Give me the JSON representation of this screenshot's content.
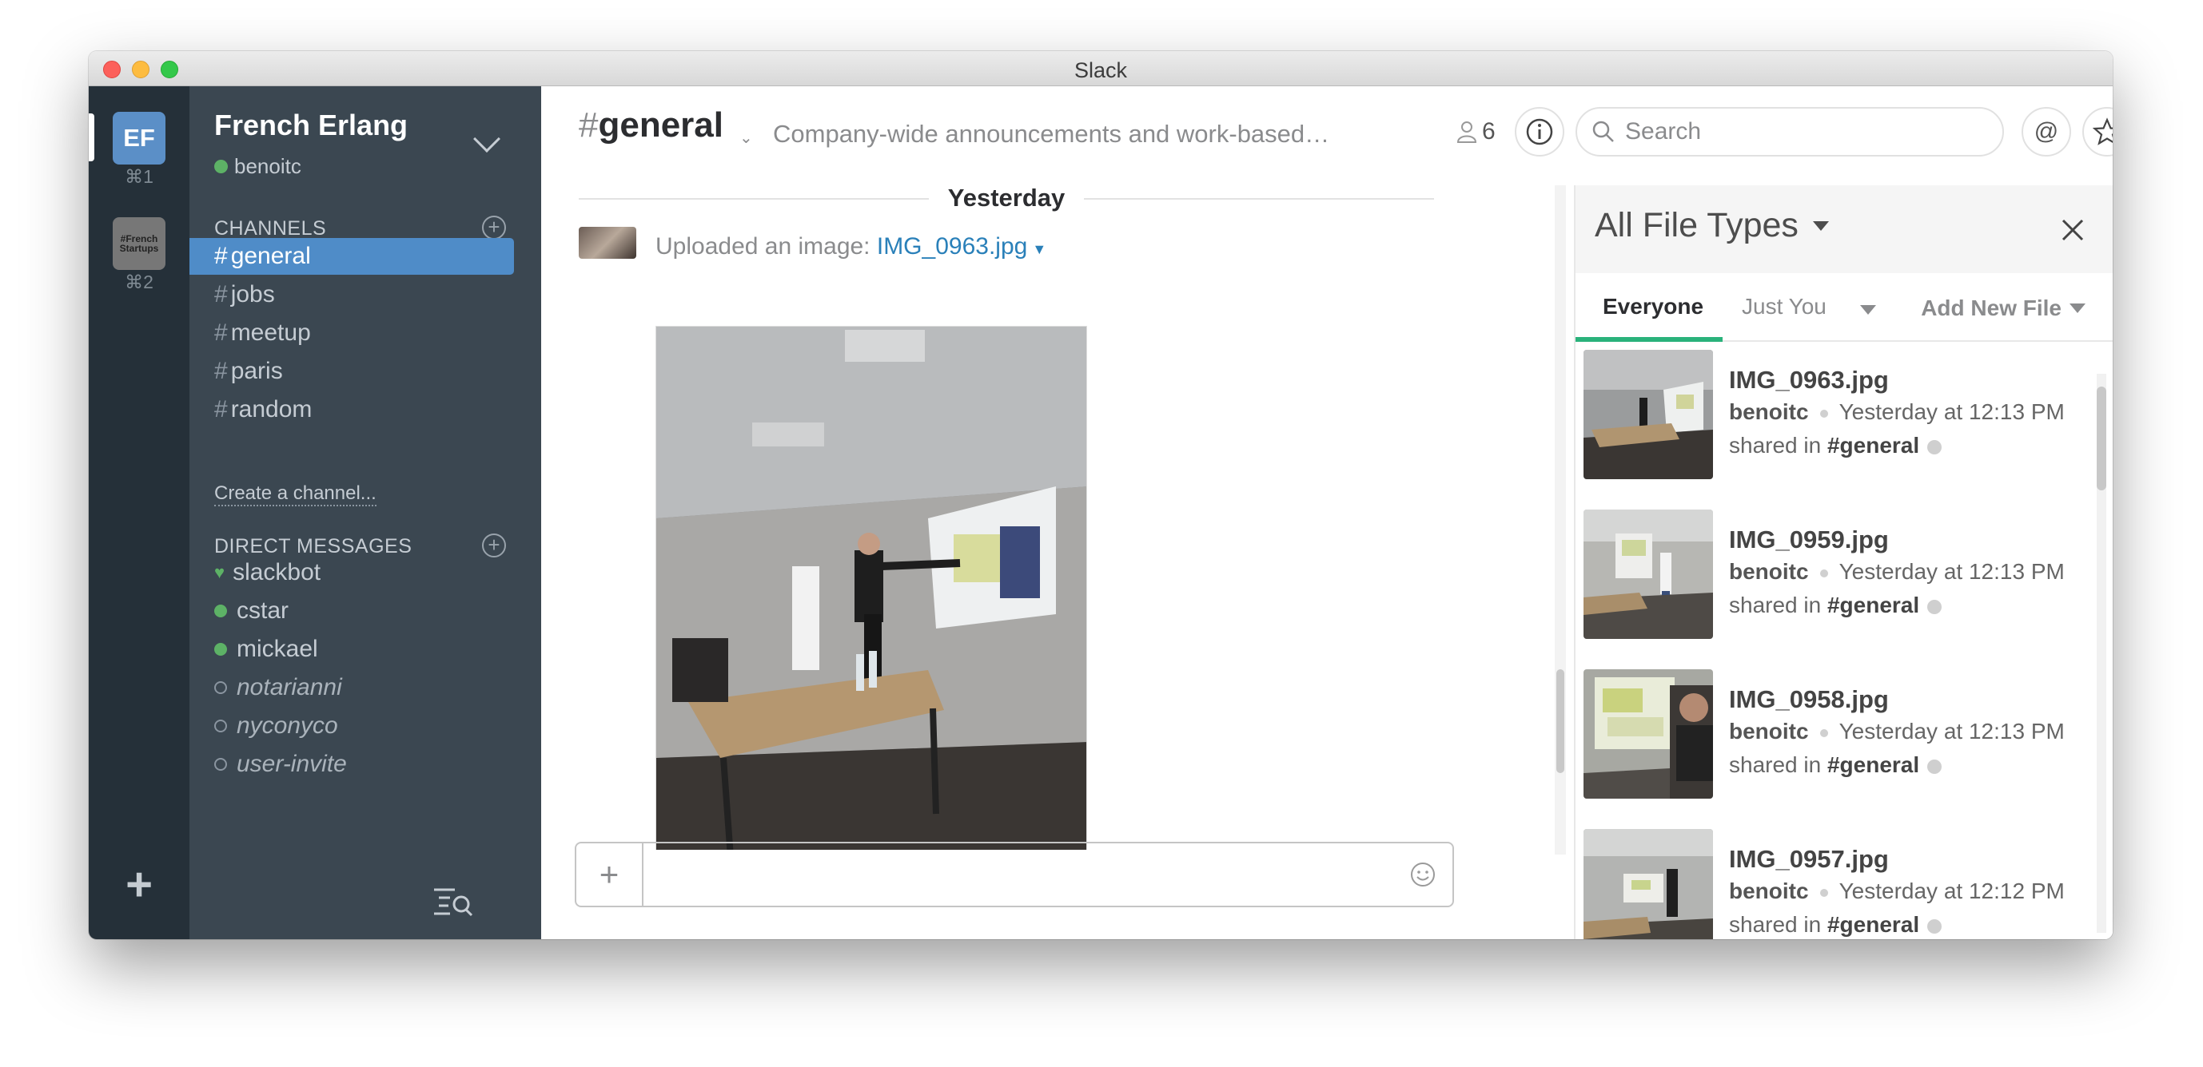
{
  "window": {
    "title": "Slack"
  },
  "teams": [
    {
      "initials": "EF",
      "shortcut": "⌘1"
    },
    {
      "logo_text": "#French Startups",
      "shortcut": "⌘2"
    }
  ],
  "sidebar": {
    "team_name": "French Erlang",
    "user": "benoitc",
    "channels_header": "CHANNELS",
    "channels": [
      {
        "name": "general",
        "active": true
      },
      {
        "name": "jobs"
      },
      {
        "name": "meetup"
      },
      {
        "name": "paris"
      },
      {
        "name": "random"
      }
    ],
    "create_channel": "Create a channel...",
    "dm_header": "DIRECT MESSAGES",
    "dms": [
      {
        "name": "slackbot",
        "status": "bot"
      },
      {
        "name": "cstar",
        "status": "online"
      },
      {
        "name": "mickael",
        "status": "online"
      },
      {
        "name": "notarianni",
        "status": "away"
      },
      {
        "name": "nyconyco",
        "status": "away"
      },
      {
        "name": "user-invite",
        "status": "away"
      }
    ]
  },
  "header": {
    "hash": "#",
    "channel": "general",
    "purpose": "Company-wide announcements and work-based m...",
    "member_count": "6",
    "search_placeholder": "Search"
  },
  "messages": {
    "day_divider": "Yesterday",
    "upload_text": "Uploaded an image: ",
    "file_link": "IMG_0963.jpg"
  },
  "flexpane": {
    "title": "All File Types",
    "tabs": {
      "everyone": "Everyone",
      "just_you": "Just You"
    },
    "add_new_file": "Add New File",
    "shared_prefix": "shared in ",
    "files": [
      {
        "name": "IMG_0963.jpg",
        "user": "benoitc",
        "time": "Yesterday at 12:13 PM",
        "channel": "#general"
      },
      {
        "name": "IMG_0959.jpg",
        "user": "benoitc",
        "time": "Yesterday at 12:13 PM",
        "channel": "#general"
      },
      {
        "name": "IMG_0958.jpg",
        "user": "benoitc",
        "time": "Yesterday at 12:13 PM",
        "channel": "#general"
      },
      {
        "name": "IMG_0957.jpg",
        "user": "benoitc",
        "time": "Yesterday at 12:12 PM",
        "channel": "#general"
      }
    ]
  },
  "colors": {
    "sidebar_bg": "#3b4751",
    "teams_bg": "#253039",
    "active_channel": "#4f8cc8",
    "link": "#2a80b9",
    "online": "#5db266",
    "tab_underline": "#2ab27b"
  }
}
